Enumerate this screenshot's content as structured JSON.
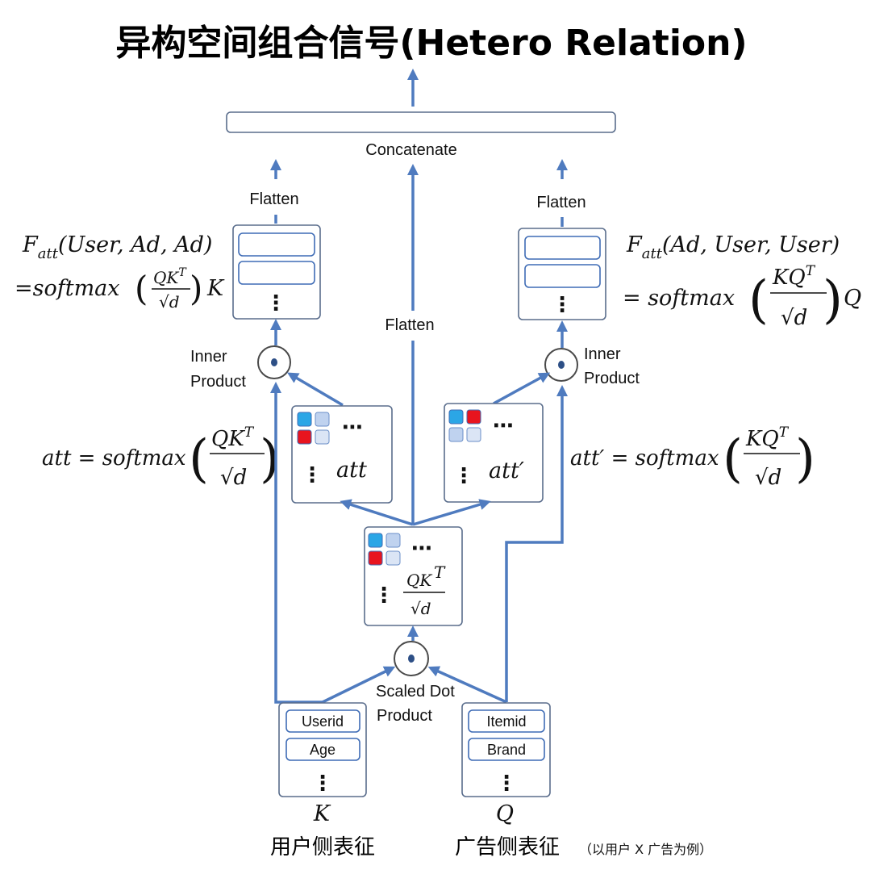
{
  "title": "异构空间组合信号(Hetero Relation)",
  "concatenate": "Concatenate",
  "flatten_left": "Flatten",
  "flatten_center": "Flatten",
  "flatten_right": "Flatten",
  "inner_product_left": [
    "Inner",
    "Product"
  ],
  "inner_product_right": [
    "Inner",
    "Product"
  ],
  "scaled_dot": [
    "Scaled Dot",
    "Product"
  ],
  "user_fields": [
    "Userid",
    "Age"
  ],
  "ad_fields": [
    "Itemid",
    "Brand"
  ],
  "user_key": "K",
  "ad_key": "Q",
  "user_caption": "用户侧表征",
  "ad_caption": "广告侧表征",
  "example_note": "（以用户 X 广告为例）",
  "att_label": "att",
  "att_prime_label": "att′",
  "formula_left_top": {
    "F": "F",
    "sub": "att",
    "args": "(User, Ad, Ad)"
  },
  "formula_left_bottom": {
    "eq": "=softmax",
    "num": "QK",
    "sup": "T",
    "den": "√d",
    "tail": "K"
  },
  "formula_right_top": {
    "F": "F",
    "sub": "att",
    "args": "(Ad, User, User)"
  },
  "formula_right_bottom": {
    "eq": "= softmax",
    "num": "KQ",
    "sup": "T",
    "den": "√d",
    "tail": "Q"
  },
  "formula_att": {
    "lhs": "att = softmax",
    "num": "QK",
    "sup": "T",
    "den": "√d"
  },
  "formula_att_prime": {
    "lhs": "att′ = softmax",
    "num": "KQ",
    "sup": "T",
    "den": "√d"
  },
  "center_fraction": {
    "num": "QK",
    "sup": "T",
    "den": "√d"
  },
  "ellipsis": "⋯",
  "vellipsis": "⋮",
  "dot_symbol": "⊙",
  "colors": {
    "line": "#4f7bbf",
    "cell_blue": "#2ba6e6",
    "cell_light": "#bfd2ef",
    "cell_red": "#e8141e"
  }
}
